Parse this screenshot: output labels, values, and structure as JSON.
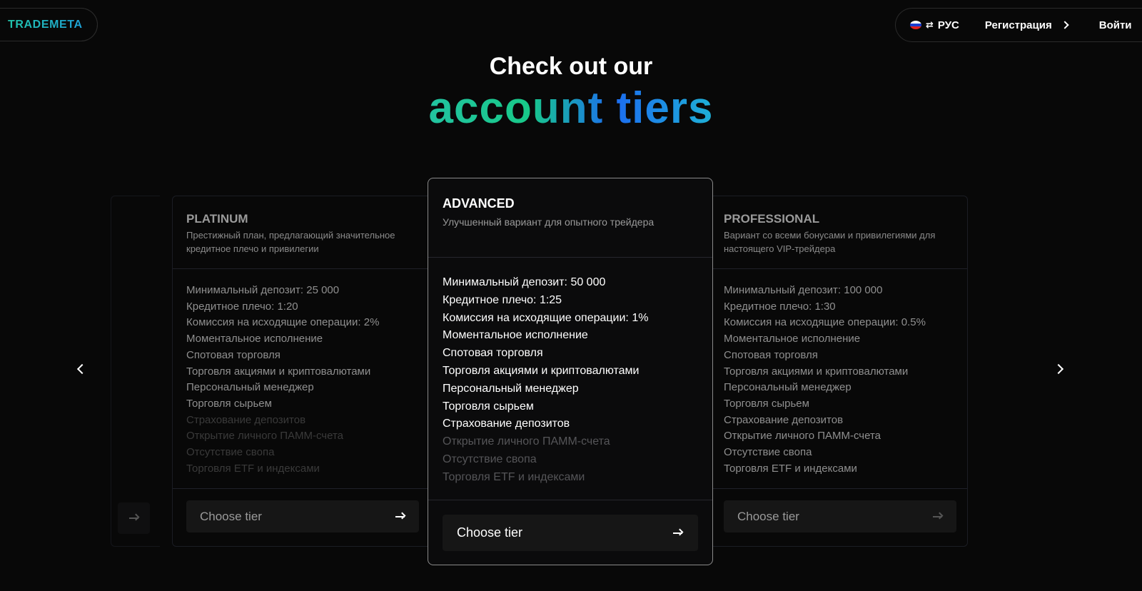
{
  "brand": {
    "logo": "TRADEMETA",
    "gradient": [
      "#21c8a6",
      "#1e9be0"
    ]
  },
  "nav": {
    "language": "РУС",
    "register": "Регистрация",
    "login": "Войти"
  },
  "hero": {
    "line1": "Check out our",
    "line2": "account tiers"
  },
  "tiers": {
    "platinum": {
      "name": "PLATINUM",
      "description": "Престижный план, предлагающий значительное кредитное плечо и привилегии",
      "features": [
        {
          "label": "Минимальный депозит: 25 000",
          "state": "mixed"
        },
        {
          "label": "Кредитное плечо: 1:20",
          "state": "mixed"
        },
        {
          "label": "Комиссия на исходящие операции: 2%",
          "state": "mixed"
        },
        {
          "label": "Моментальное исполнение",
          "state": "mixed"
        },
        {
          "label": "Спотовая торговля",
          "state": "mixed"
        },
        {
          "label": "Торговля акциями и криптовалютами",
          "state": "mixed"
        },
        {
          "label": "Персональный менеджер",
          "state": "mixed"
        },
        {
          "label": "Торговля сырьем",
          "state": "mixed"
        },
        {
          "label": "Страхование депозитов",
          "state": "unavailable"
        },
        {
          "label": "Открытие личного ПАММ-счета",
          "state": "unavailable"
        },
        {
          "label": "Отсутствие свопа",
          "state": "unavailable"
        },
        {
          "label": "Торговля ETF и индексами",
          "state": "unavailable"
        }
      ],
      "button": "Choose tier"
    },
    "advanced": {
      "name": "ADVANCED",
      "description": "Улучшенный вариант для опытного трейдера",
      "features": [
        {
          "label": "Минимальный депозит: 50 000",
          "state": "included"
        },
        {
          "label": "Кредитное плечо: 1:25",
          "state": "included"
        },
        {
          "label": "Комиссия на исходящие операции: 1%",
          "state": "included"
        },
        {
          "label": "Моментальное исполнение",
          "state": "included"
        },
        {
          "label": "Спотовая торговля",
          "state": "included"
        },
        {
          "label": "Торговля акциями и криптовалютами",
          "state": "included"
        },
        {
          "label": "Персональный менеджер",
          "state": "included"
        },
        {
          "label": "Торговля сырьем",
          "state": "included"
        },
        {
          "label": "Страхование депозитов",
          "state": "included"
        },
        {
          "label": "Открытие личного ПАММ-счета",
          "state": "unavailable"
        },
        {
          "label": "Отсутствие свопа",
          "state": "unavailable"
        },
        {
          "label": "Торговля ETF и индексами",
          "state": "unavailable"
        }
      ],
      "button": "Choose tier"
    },
    "professional": {
      "name": "PROFESSIONAL",
      "description": "Вариант со всеми бонусами и привилегиями для настоящего VIP-трейдера",
      "features": [
        {
          "label": "Минимальный депозит: 100 000",
          "state": "mixed"
        },
        {
          "label": "Кредитное плечо: 1:30",
          "state": "mixed"
        },
        {
          "label": "Комиссия на исходящие операции: 0.5%",
          "state": "mixed"
        },
        {
          "label": "Моментальное исполнение",
          "state": "mixed"
        },
        {
          "label": "Спотовая торговля",
          "state": "mixed"
        },
        {
          "label": "Торговля акциями и криптовалютами",
          "state": "mixed"
        },
        {
          "label": "Персональный менеджер",
          "state": "mixed"
        },
        {
          "label": "Торговля сырьем",
          "state": "mixed"
        },
        {
          "label": "Страхование депозитов",
          "state": "mixed"
        },
        {
          "label": "Открытие личного ПАММ-счета",
          "state": "mixed"
        },
        {
          "label": "Отсутствие свопа",
          "state": "mixed"
        },
        {
          "label": "Торговля ETF и индексами",
          "state": "mixed"
        }
      ],
      "button": "Choose tier"
    }
  },
  "colors": {
    "background": "#080808",
    "accent_green": "#18c989",
    "accent_blue": "#1c6cf0"
  },
  "icons": {
    "prev": "chevron-left-icon",
    "next": "chevron-right-icon",
    "button_arrow": "arrow-right-icon",
    "flag": "russia-flag-icon",
    "swap": "swap-icon"
  }
}
